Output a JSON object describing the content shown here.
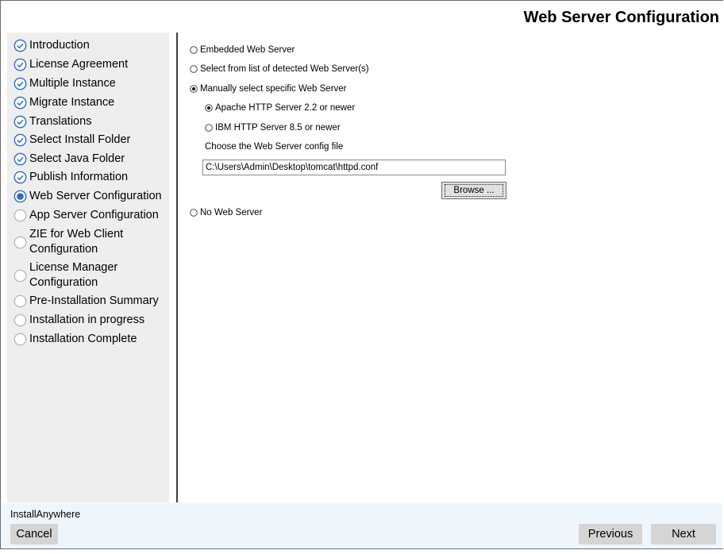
{
  "header": {
    "title": "Web Server Configuration"
  },
  "steps": [
    {
      "label": "Introduction",
      "status": "done"
    },
    {
      "label": "License Agreement",
      "status": "done"
    },
    {
      "label": "Multiple Instance",
      "status": "done"
    },
    {
      "label": "Migrate Instance",
      "status": "done"
    },
    {
      "label": "Translations",
      "status": "done"
    },
    {
      "label": "Select Install Folder",
      "status": "done"
    },
    {
      "label": "Select Java Folder",
      "status": "done"
    },
    {
      "label": "Publish Information",
      "status": "done"
    },
    {
      "label": "Web Server Configuration",
      "status": "current"
    },
    {
      "label": "App Server Configuration",
      "status": "pending"
    },
    {
      "label_line1": "ZIE for Web Client",
      "label_line2": "Configuration",
      "status": "pending"
    },
    {
      "label_line1": "License Manager",
      "label_line2": "Configuration",
      "status": "pending"
    },
    {
      "label": "Pre-Installation Summary",
      "status": "pending"
    },
    {
      "label": "Installation in progress",
      "status": "pending"
    },
    {
      "label": "Installation Complete",
      "status": "pending"
    }
  ],
  "options": {
    "embedded": {
      "label": "Embedded Web Server",
      "selected": false
    },
    "detected": {
      "label": "Select from list of detected Web Server(s)",
      "selected": false
    },
    "manual": {
      "label": "Manually select specific Web Server",
      "selected": true
    },
    "apache": {
      "label": "Apache HTTP Server 2.2 or newer",
      "selected": true
    },
    "ibm": {
      "label": "IBM HTTP Server 8.5 or newer",
      "selected": false
    },
    "none": {
      "label": "No Web Server",
      "selected": false
    }
  },
  "config": {
    "label": "Choose the Web Server config file",
    "path": "C:\\Users\\Admin\\Desktop\\tomcat\\httpd.conf",
    "browse_label": "Browse ..."
  },
  "footer": {
    "brand": "InstallAnywhere",
    "cancel_label": "Cancel",
    "previous_label": "Previous",
    "next_label": "Next"
  },
  "colors": {
    "accent": "#2b6fc0",
    "sidebar_bg": "#eeeeee",
    "footer_bg": "#eef6fd"
  },
  "icons": {
    "done": "check-circle-icon",
    "current": "radio-selected-icon",
    "pending": "empty-circle-icon"
  }
}
